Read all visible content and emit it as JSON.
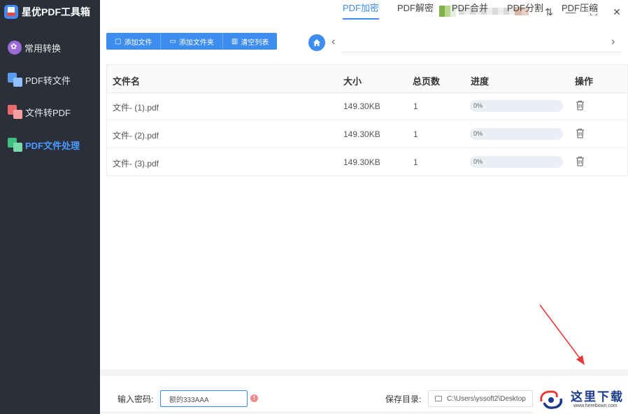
{
  "app": {
    "title": "星优PDF工具箱",
    "accent": "#3d8cf0",
    "sidebar_bg": "#2b2f3a"
  },
  "sidebar": {
    "items": [
      {
        "label": "常用转换",
        "icon": "flower-circle-icon",
        "active": false
      },
      {
        "label": "PDF转文件",
        "icon": "pdf-to-file-icon",
        "active": false
      },
      {
        "label": "文件转PDF",
        "icon": "file-to-pdf-icon",
        "active": false
      },
      {
        "label": "PDF文件处理",
        "icon": "pdf-process-icon",
        "active": true
      }
    ]
  },
  "window_controls": {
    "settings": "⇅",
    "minimize": "—",
    "maximize": "⛶",
    "close": "✕"
  },
  "toolbar": {
    "add_file": "添加文件",
    "add_folder": "添加文件夹",
    "clear_list": "清空列表"
  },
  "tabs": {
    "items": [
      "PDF加密",
      "PDF解密",
      "PDF合并",
      "PDF分割",
      "PDF压缩"
    ],
    "active_index": 0
  },
  "table": {
    "headers": {
      "name": "文件名",
      "size": "大小",
      "pages": "总页数",
      "progress": "进度",
      "action": "操作"
    },
    "rows": [
      {
        "name": "文件- (1).pdf",
        "size": "149.30KB",
        "pages": "1",
        "progress": "0%"
      },
      {
        "name": "文件- (2).pdf",
        "size": "149.30KB",
        "pages": "1",
        "progress": "0%"
      },
      {
        "name": "文件- (3).pdf",
        "size": "149.30KB",
        "pages": "1",
        "progress": "0%"
      }
    ]
  },
  "bottom": {
    "password_label": "输入密码:",
    "password_value": "额的333AAA",
    "warn_glyph": "!",
    "save_dir_label": "保存目录:",
    "save_dir_value": "C:\\Users\\yssoft2\\Desktop"
  },
  "watermark": {
    "text": "这里下载",
    "sub": "www.herebown.com"
  }
}
